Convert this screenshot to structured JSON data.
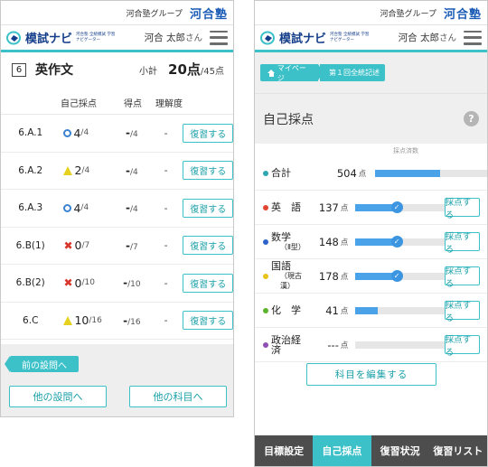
{
  "header": {
    "group_text": "河合塾グループ",
    "brand": "河合塾",
    "app_name": "模試ナビ",
    "app_tagline": "河合塾 全統模試 学習ナビゲーター",
    "user_name": "河合 太郎",
    "user_suffix": "さん"
  },
  "left": {
    "question_number": "6",
    "question_title": "英作文",
    "subtotal_label": "小計",
    "subtotal_value": "20点",
    "subtotal_max": "/45点",
    "columns": [
      "自己採点",
      "得点",
      "理解度"
    ],
    "rows": [
      {
        "id": "6.A.1",
        "mark": "circle",
        "self": "4",
        "self_max": "/4",
        "score": "-",
        "score_max": "/4",
        "understanding": "-",
        "button": "復習する"
      },
      {
        "id": "6.A.2",
        "mark": "triangle",
        "self": "2",
        "self_max": "/4",
        "score": "-",
        "score_max": "/4",
        "understanding": "-",
        "button": "復習する"
      },
      {
        "id": "6.A.3",
        "mark": "circle",
        "self": "4",
        "self_max": "/4",
        "score": "-",
        "score_max": "/4",
        "understanding": "-",
        "button": "復習する"
      },
      {
        "id": "6.B(1)",
        "mark": "cross",
        "self": "0",
        "self_max": "/7",
        "score": "-",
        "score_max": "/7",
        "understanding": "-",
        "button": "復習する"
      },
      {
        "id": "6.B(2)",
        "mark": "cross",
        "self": "0",
        "self_max": "/10",
        "score": "-",
        "score_max": "/10",
        "understanding": "-",
        "button": "復習する"
      },
      {
        "id": "6.C",
        "mark": "triangle",
        "self": "10",
        "self_max": "/16",
        "score": "-",
        "score_max": "/16",
        "understanding": "-",
        "button": "復習する"
      }
    ],
    "prev_question": "前の設問へ",
    "other_questions": "他の設問へ",
    "other_subjects": "他の科目へ"
  },
  "right": {
    "breadcrumb_home": "マイページ",
    "breadcrumb_current": "第１回全統記述",
    "section_title": "自己採点",
    "help": "?",
    "scale_label": "採点済数",
    "point_unit": "点",
    "subjects": [
      {
        "name": "合計",
        "sub": "",
        "color": "#2aa7b0",
        "score": "504",
        "fill": 0.58,
        "checked": false,
        "button": ""
      },
      {
        "name": "英　語",
        "sub": "",
        "color": "#e0462f",
        "score": "137",
        "fill": 0.43,
        "checked": true,
        "button": "採点する"
      },
      {
        "name": "数学",
        "sub": "（Ⅱ型）",
        "color": "#2d63c8",
        "score": "148",
        "fill": 0.43,
        "checked": true,
        "button": "採点する"
      },
      {
        "name": "国語",
        "sub": "（現古漢）",
        "color": "#e8c21a",
        "score": "178",
        "fill": 0.43,
        "checked": true,
        "button": "採点する"
      },
      {
        "name": "化　学",
        "sub": "",
        "color": "#5ab32b",
        "score": "41",
        "fill": 0.25,
        "checked": false,
        "button": "採点する"
      },
      {
        "name": "政治経済",
        "sub": "",
        "color": "#8e4fb6",
        "score": "---",
        "fill": 0,
        "checked": false,
        "button": "採点する"
      }
    ],
    "edit_subjects": "科目を編集する",
    "nav": [
      "目標設定",
      "自己採点",
      "復習状況",
      "復習リスト"
    ],
    "nav_active": 1
  }
}
